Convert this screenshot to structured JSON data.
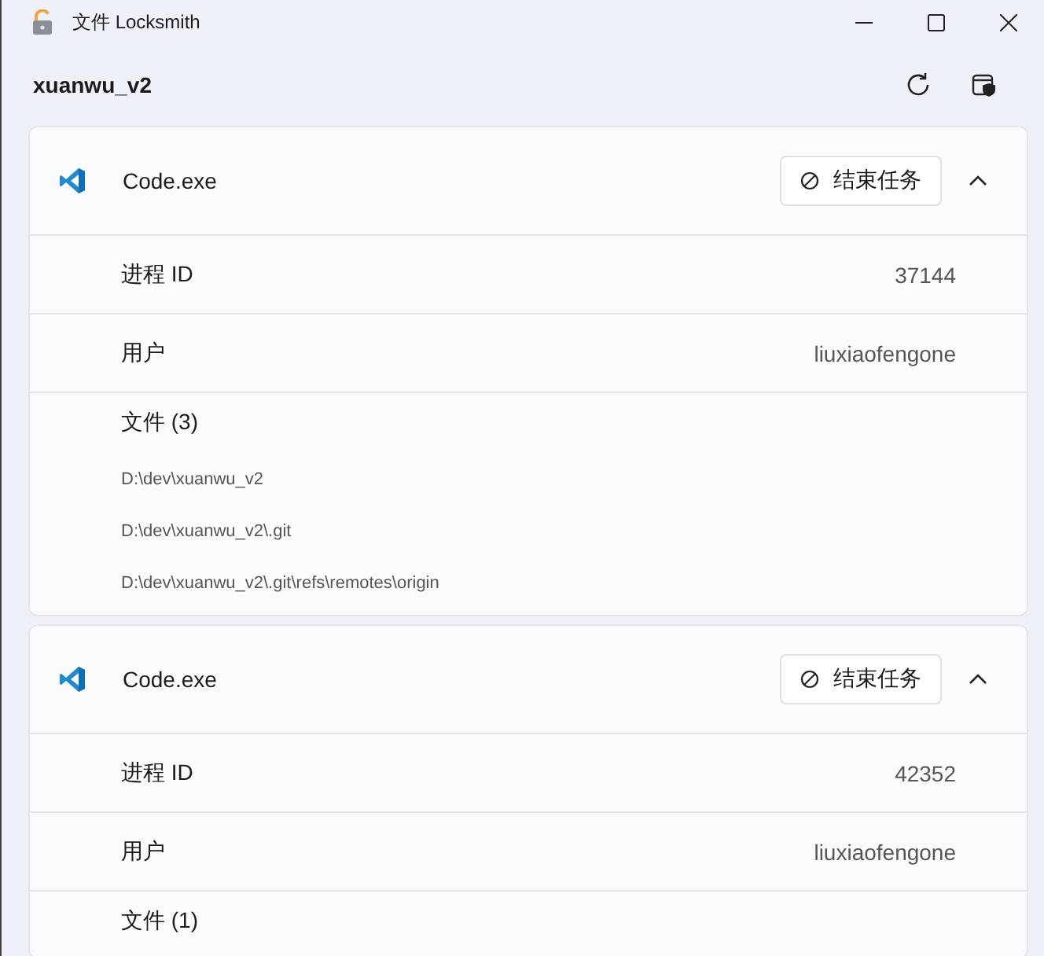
{
  "window": {
    "title": "文件 Locksmith"
  },
  "header": {
    "title": "xuanwu_v2"
  },
  "processes": [
    {
      "name": "Code.exe",
      "end_button": "结束任务",
      "expanded": true,
      "fields": [
        {
          "label": "进程 ID",
          "value": "37144"
        },
        {
          "label": "用户",
          "value": "liuxiaofengone"
        }
      ],
      "files_label": "文件 (3)",
      "files": [
        "D:\\dev\\xuanwu_v2",
        "D:\\dev\\xuanwu_v2\\.git",
        "D:\\dev\\xuanwu_v2\\.git\\refs\\remotes\\origin"
      ]
    },
    {
      "name": "Code.exe",
      "end_button": "结束任务",
      "expanded": true,
      "fields": [
        {
          "label": "进程 ID",
          "value": "42352"
        },
        {
          "label": "用户",
          "value": "liuxiaofengone"
        }
      ],
      "files_label": "文件 (1)"
    }
  ]
}
